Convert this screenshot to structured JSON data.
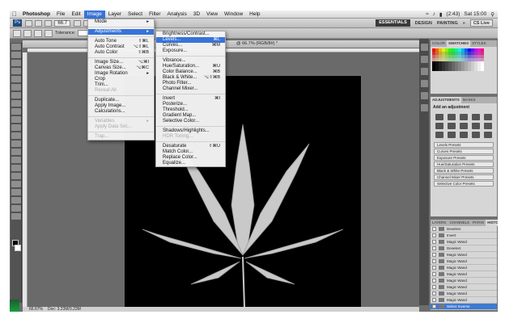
{
  "menubar": {
    "app": "Photoshop",
    "items": [
      "File",
      "Edit",
      "Image",
      "Layer",
      "Select",
      "Filter",
      "Analysis",
      "3D",
      "View",
      "Window",
      "Help"
    ],
    "active": "Image",
    "clock": "Sat 15:00",
    "battery": "(2:43)"
  },
  "appbar": {
    "logo": "Ps",
    "zoom": "66.7",
    "workspaces": [
      "ESSENTIALS",
      "DESIGN",
      "PAINTING",
      "»"
    ],
    "cs_live": "CS Live"
  },
  "options": {
    "tolerance_label": "Tolerance:"
  },
  "document": {
    "title": "@ 66.7% (RGB/8#) *"
  },
  "status": {
    "zoom": "66.67%",
    "doc": "Doc: 3.23M/3.23M"
  },
  "image_menu": {
    "items": [
      {
        "label": "Mode",
        "shortcut": "▸",
        "state": "normal"
      },
      {
        "sep": true
      },
      {
        "label": "Adjustments",
        "shortcut": "▸",
        "state": "highlight"
      },
      {
        "sep": true
      },
      {
        "label": "Auto Tone",
        "shortcut": "⇧⌘L",
        "state": "normal"
      },
      {
        "label": "Auto Contrast",
        "shortcut": "⌥⇧⌘L",
        "state": "normal"
      },
      {
        "label": "Auto Color",
        "shortcut": "⇧⌘B",
        "state": "normal"
      },
      {
        "sep": true
      },
      {
        "label": "Image Size...",
        "shortcut": "⌥⌘I",
        "state": "normal"
      },
      {
        "label": "Canvas Size...",
        "shortcut": "⌥⌘C",
        "state": "normal"
      },
      {
        "label": "Image Rotation",
        "shortcut": "▸",
        "state": "normal"
      },
      {
        "label": "Crop",
        "shortcut": "",
        "state": "normal"
      },
      {
        "label": "Trim...",
        "shortcut": "",
        "state": "normal"
      },
      {
        "label": "Reveal All",
        "shortcut": "",
        "state": "disabled"
      },
      {
        "sep": true
      },
      {
        "label": "Duplicate...",
        "shortcut": "",
        "state": "normal"
      },
      {
        "label": "Apply Image...",
        "shortcut": "",
        "state": "normal"
      },
      {
        "label": "Calculations...",
        "shortcut": "",
        "state": "normal"
      },
      {
        "sep": true
      },
      {
        "label": "Variables",
        "shortcut": "▸",
        "state": "disabled"
      },
      {
        "label": "Apply Data Set...",
        "shortcut": "",
        "state": "disabled"
      },
      {
        "sep": true
      },
      {
        "label": "Trap...",
        "shortcut": "",
        "state": "disabled"
      }
    ]
  },
  "adjust_menu": {
    "items": [
      {
        "label": "Brightness/Contrast...",
        "shortcut": "",
        "state": "normal"
      },
      {
        "label": "Levels...",
        "shortcut": "⌘L",
        "state": "highlight"
      },
      {
        "label": "Curves...",
        "shortcut": "⌘M",
        "state": "normal"
      },
      {
        "label": "Exposure...",
        "shortcut": "",
        "state": "normal"
      },
      {
        "sep": true
      },
      {
        "label": "Vibrance...",
        "shortcut": "",
        "state": "normal"
      },
      {
        "label": "Hue/Saturation...",
        "shortcut": "⌘U",
        "state": "normal"
      },
      {
        "label": "Color Balance...",
        "shortcut": "⌘B",
        "state": "normal"
      },
      {
        "label": "Black & White...",
        "shortcut": "⌥⇧⌘B",
        "state": "normal"
      },
      {
        "label": "Photo Filter...",
        "shortcut": "",
        "state": "normal"
      },
      {
        "label": "Channel Mixer...",
        "shortcut": "",
        "state": "normal"
      },
      {
        "sep": true
      },
      {
        "label": "Invert",
        "shortcut": "⌘I",
        "state": "normal"
      },
      {
        "label": "Posterize...",
        "shortcut": "",
        "state": "normal"
      },
      {
        "label": "Threshold...",
        "shortcut": "",
        "state": "normal"
      },
      {
        "label": "Gradient Map...",
        "shortcut": "",
        "state": "normal"
      },
      {
        "label": "Selective Color...",
        "shortcut": "",
        "state": "normal"
      },
      {
        "sep": true
      },
      {
        "label": "Shadows/Highlights...",
        "shortcut": "",
        "state": "normal"
      },
      {
        "label": "HDR Toning...",
        "shortcut": "",
        "state": "disabled"
      },
      {
        "sep": true
      },
      {
        "label": "Desaturate",
        "shortcut": "⇧⌘U",
        "state": "normal"
      },
      {
        "label": "Match Color...",
        "shortcut": "",
        "state": "normal"
      },
      {
        "label": "Replace Color...",
        "shortcut": "",
        "state": "normal"
      },
      {
        "label": "Equalize...",
        "shortcut": "",
        "state": "normal"
      }
    ]
  },
  "panels": {
    "swatch_tabs": [
      "COLOR",
      "SWATCHES",
      "STYLES"
    ],
    "adj_tabs": [
      "ADJUSTMENTS",
      "MASKS"
    ],
    "adj_heading": "Add an adjustment",
    "presets": [
      "Levels Presets",
      "Curves Presets",
      "Exposure Presets",
      "Hue/Saturation Presets",
      "Black & White Presets",
      "Channel Mixer Presets",
      "Selective Color Presets"
    ],
    "history_tabs": [
      "LAYERS",
      "CHANNELS",
      "PATHS",
      "HISTORY"
    ],
    "history": [
      {
        "label": "Deselect",
        "selected": false
      },
      {
        "label": "Invert",
        "selected": false
      },
      {
        "label": "Magic Wand",
        "selected": false
      },
      {
        "label": "Deselect",
        "selected": false
      },
      {
        "label": "Magic Wand",
        "selected": false
      },
      {
        "label": "Magic Wand",
        "selected": false
      },
      {
        "label": "Magic Wand",
        "selected": false
      },
      {
        "label": "Magic Wand",
        "selected": false
      },
      {
        "label": "Magic Wand",
        "selected": false
      },
      {
        "label": "Magic Wand",
        "selected": false
      },
      {
        "label": "Magic Wand",
        "selected": false
      },
      {
        "label": "Magic Wand",
        "selected": false
      },
      {
        "label": "Select Inverse",
        "selected": true
      }
    ]
  },
  "colors": {
    "accent": "#3874d8",
    "canvas": "#000000",
    "leaf": "#c8c8c8"
  }
}
